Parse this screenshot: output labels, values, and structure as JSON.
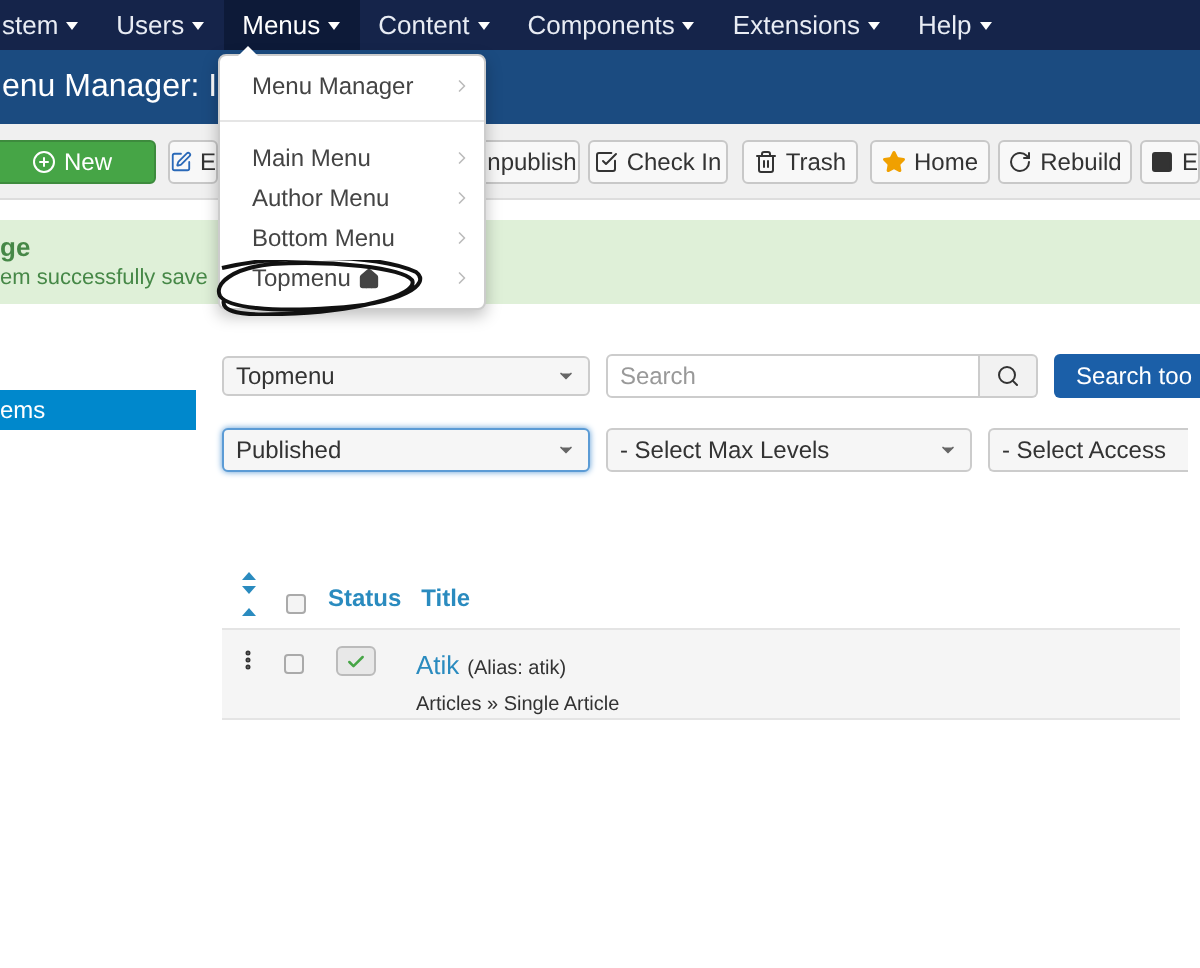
{
  "nav": [
    {
      "label": "stem",
      "selected": false
    },
    {
      "label": "Users",
      "selected": false
    },
    {
      "label": "Menus",
      "selected": true
    },
    {
      "label": "Content",
      "selected": false
    },
    {
      "label": "Components",
      "selected": false
    },
    {
      "label": "Extensions",
      "selected": false
    },
    {
      "label": "Help",
      "selected": false
    }
  ],
  "page_title": "enu Manager: I",
  "toolbar": [
    {
      "label": "New",
      "kind": "plus"
    },
    {
      "label": "E",
      "kind": "edit"
    },
    {
      "label": "npublish",
      "kind": "plain"
    },
    {
      "label": "Check In",
      "kind": "check"
    },
    {
      "label": "Trash",
      "kind": "trash"
    },
    {
      "label": "Home",
      "kind": "star"
    },
    {
      "label": "Rebuild",
      "kind": "rebuild"
    },
    {
      "label": "E",
      "kind": "square"
    }
  ],
  "message": {
    "heading": "ge",
    "text": "em successfully save"
  },
  "dropdown": {
    "groups": [
      [
        {
          "label": "Menu Manager",
          "home": false
        }
      ],
      [
        {
          "label": "Main Menu",
          "home": false
        },
        {
          "label": "Author Menu",
          "home": false
        },
        {
          "label": "Bottom Menu",
          "home": false
        },
        {
          "label": "Topmenu",
          "home": true
        }
      ]
    ]
  },
  "sidebar": [
    {
      "label": "ems",
      "selected": true
    }
  ],
  "menu_select": "Topmenu",
  "search": {
    "placeholder": "Search"
  },
  "search_tools": "Search too",
  "filters": [
    {
      "value": "Published",
      "focused": true
    },
    {
      "value": "- Select Max Levels",
      "focused": false
    },
    {
      "value": "- Select Access",
      "focused": false
    }
  ],
  "table": {
    "columns": [
      "Status",
      "Title"
    ],
    "select_all": {
      "checked": false
    },
    "rows": [
      {
        "title": "Atik",
        "alias": "(Alias: atik)",
        "type": "Articles » Single Article",
        "checked": false,
        "published": true
      }
    ]
  }
}
